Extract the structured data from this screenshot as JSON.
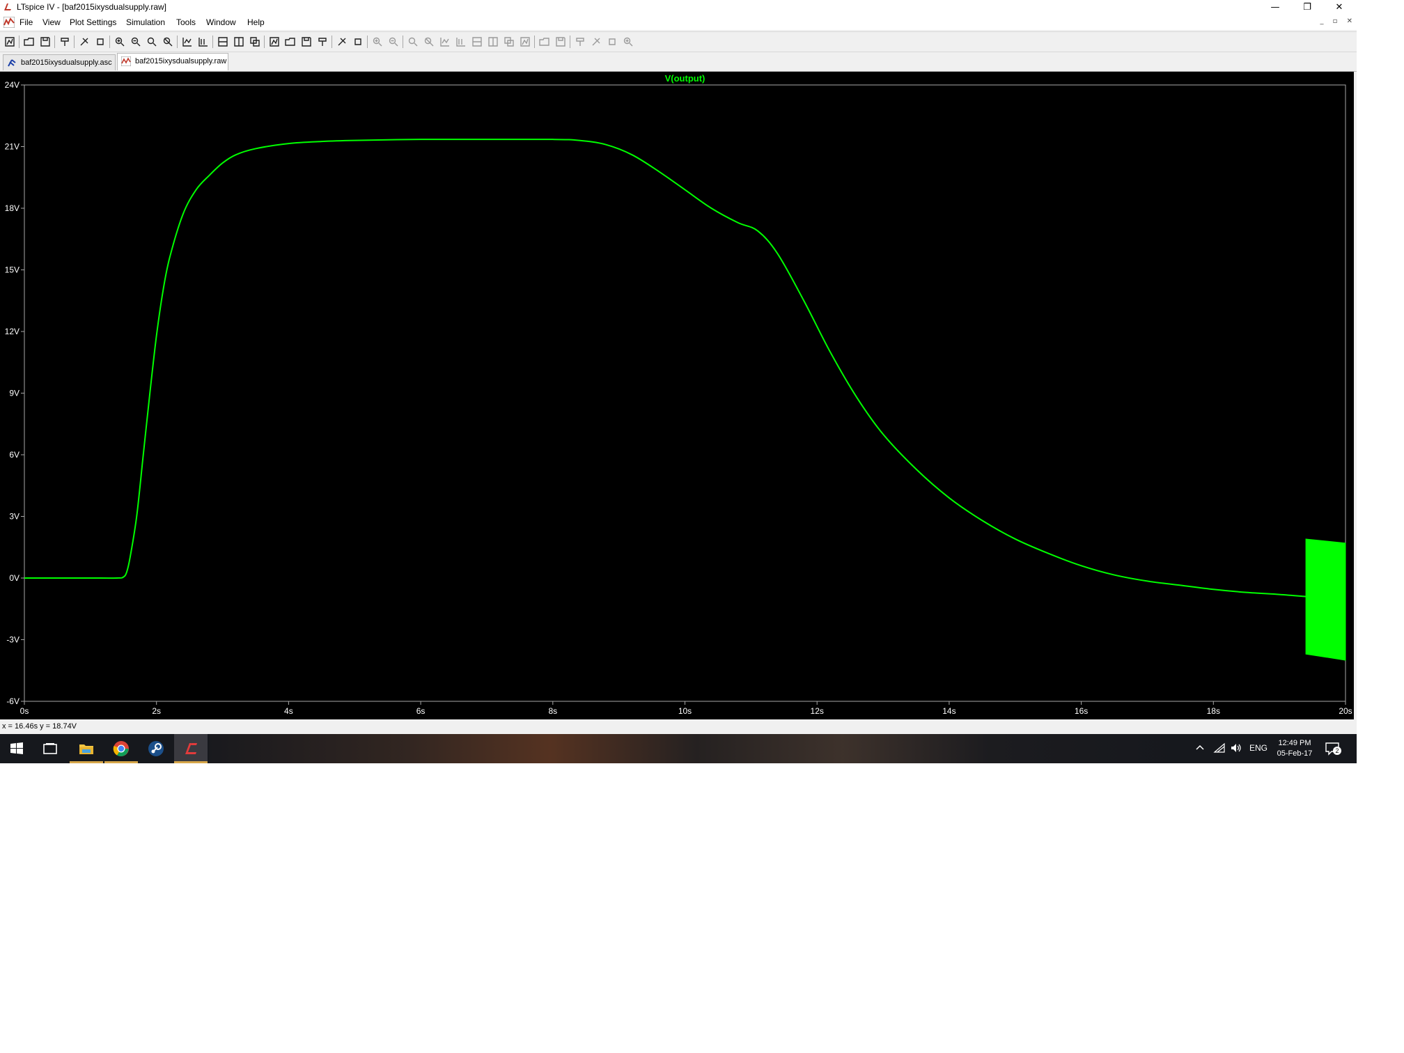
{
  "window": {
    "title": "LTspice IV - [baf2015ixysdualsupply.raw]",
    "minimize_glyph": "—",
    "maximize_glyph": "❐",
    "close_glyph": "✕"
  },
  "menu": {
    "items": [
      "File",
      "View",
      "Plot Settings",
      "Simulation",
      "Tools",
      "Window",
      "Help"
    ],
    "mdi_glyphs": [
      "_",
      "▫",
      "✕"
    ]
  },
  "toolbar": {
    "icons": [
      "new-schematic-icon",
      "open-icon",
      "save-icon",
      "control-panel-icon",
      "run-icon",
      "halt-icon",
      "zoom-in-icon",
      "zoom-out-icon",
      "zoom-full-icon",
      "zoom-cancel-icon",
      "autorange-icon",
      "pick-traces-icon",
      "tile-horizontal-icon",
      "tile-vertical-icon",
      "cascade-icon",
      "cut-icon",
      "copy-icon",
      "paste-icon",
      "find-icon",
      "print-preview-icon",
      "print-icon",
      "wire-icon",
      "ground-icon",
      "label-icon",
      "resistor-icon",
      "capacitor-icon",
      "inductor-icon",
      "diode-icon",
      "component-icon",
      "move-icon",
      "drag-icon",
      "undo-icon",
      "redo-icon",
      "rotate-icon",
      "mirror-icon",
      "text-icon",
      "spice-directive-icon"
    ]
  },
  "tabs": [
    {
      "label": "baf2015ixysdualsupply.asc",
      "icon": "schematic-icon",
      "active": false
    },
    {
      "label": "baf2015ixysdualsupply.raw",
      "icon": "waveform-icon",
      "active": true
    }
  ],
  "statusbar": {
    "coordinates": "x = 16.46s    y = 18.74V"
  },
  "taskbar": {
    "apps": [
      "start-icon",
      "task-view-icon",
      "file-explorer-icon",
      "chrome-icon",
      "steam-icon",
      "ltspice-icon"
    ],
    "language": "ENG",
    "time": "12:49 PM",
    "date": "05-Feb-17",
    "notification_count": "2"
  },
  "colors": {
    "trace": "#00ff00",
    "plot_background": "#000000",
    "axis_text": "#ffffff",
    "axis_frame": "#a8a8a8"
  },
  "chart_data": {
    "type": "line",
    "title": "V(output)",
    "xlabel": "",
    "ylabel": "",
    "xlim": [
      0,
      20
    ],
    "ylim": [
      -6,
      24
    ],
    "x_ticks": [
      "0s",
      "2s",
      "4s",
      "6s",
      "8s",
      "10s",
      "12s",
      "14s",
      "16s",
      "18s",
      "20s"
    ],
    "y_ticks": [
      "24V",
      "21V",
      "18V",
      "15V",
      "12V",
      "9V",
      "6V",
      "3V",
      "0V",
      "-3V",
      "-6V"
    ],
    "grid": false,
    "series": [
      {
        "name": "V(output)",
        "x": [
          0,
          0.5,
          1.0,
          1.4,
          1.5,
          1.55,
          1.6,
          1.7,
          1.8,
          1.9,
          2.0,
          2.1,
          2.2,
          2.4,
          2.6,
          2.8,
          3.0,
          3.2,
          3.5,
          4.0,
          4.5,
          5.0,
          6.0,
          7.0,
          8.0,
          8.4,
          8.8,
          9.2,
          9.6,
          10.0,
          10.4,
          10.8,
          11.1,
          11.4,
          11.8,
          12.2,
          12.6,
          13.0,
          13.5,
          14.0,
          14.5,
          15.0,
          15.5,
          16.0,
          16.5,
          17.0,
          17.5,
          18.0,
          18.5,
          19.0,
          19.4
        ],
        "y": [
          0,
          0,
          0,
          0,
          0.05,
          0.3,
          1.0,
          3.0,
          6.0,
          9.0,
          11.8,
          14.0,
          15.6,
          17.7,
          18.9,
          19.6,
          20.2,
          20.6,
          20.9,
          21.15,
          21.25,
          21.3,
          21.35,
          21.35,
          21.35,
          21.3,
          21.1,
          20.6,
          19.8,
          18.9,
          18.0,
          17.3,
          16.9,
          15.8,
          13.5,
          11.0,
          8.8,
          7.0,
          5.3,
          3.9,
          2.8,
          1.9,
          1.2,
          0.6,
          0.15,
          -0.15,
          -0.35,
          -0.55,
          -0.7,
          -0.8,
          -0.9
        ]
      }
    ],
    "annotations": [
      {
        "type": "dense-oscillation-band",
        "x_start": 19.4,
        "x_end": 20.0,
        "y_top_start": 1.9,
        "y_top_end": 1.7,
        "y_bottom_start": -3.7,
        "y_bottom_end": -4.0
      }
    ]
  }
}
